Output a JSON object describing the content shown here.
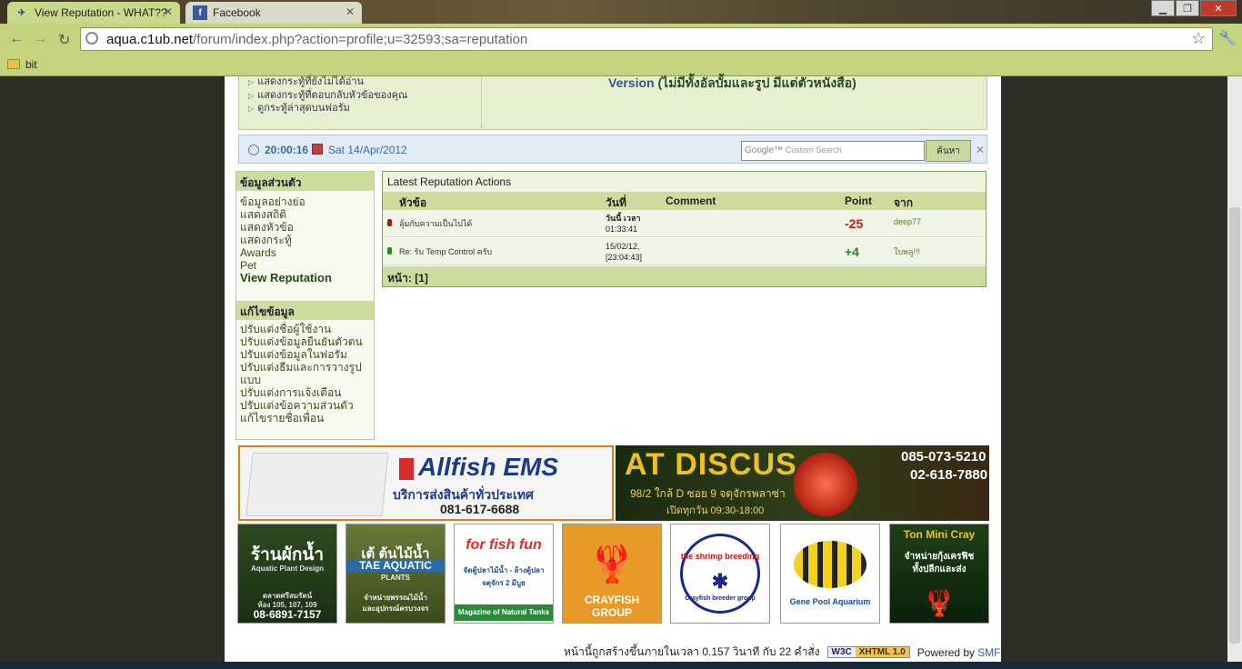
{
  "browser": {
    "tabs": [
      {
        "label": "View Reputation - WHAT??",
        "active": true
      },
      {
        "label": "Facebook",
        "active": false
      }
    ],
    "url_host": "aqua.c1ub.net",
    "url_path": "/forum/index.php?action=profile;u=32593;sa=reputation",
    "bookmarks": [
      "bit"
    ]
  },
  "menu": {
    "items": [
      "แสดงกระทู้ที่ยังไม่ได้อ่าน",
      "แสดงกระทู้ที่ตอบกลับหัวข้อของคุณ",
      "ดูกระทู้ล่าสุดบนฟอรัม"
    ],
    "version_label": "Version",
    "version_note": "(ไม่มีทั้งอัลบั้มและรูป มีแต่ตัวหนังสือ)"
  },
  "clock": {
    "time": "20:00:16",
    "date": "Sat 14/Apr/2012"
  },
  "search": {
    "placeholder": "Custom Search",
    "google": "Google™",
    "button": "ค้นหา"
  },
  "sidebar": {
    "profile_header": "ข้อมูลส่วนตัว",
    "profile_links": [
      "ข้อมูลอย่างย่อ",
      "แสดงสถิติ",
      "แสดงหัวข้อ",
      "แสดงกระทู้",
      "Awards",
      "Pet",
      "View Reputation"
    ],
    "edit_header": "แก้ไขข้อมูล",
    "edit_links": [
      "ปรับแต่งชื่อผู้ใช้งาน",
      "ปรับแต่งข้อมูลยืนยันตัวตน",
      "ปรับแต่งข้อมูลในฟอรัม",
      "ปรับแต่งธีมและการวางรูปแบบ",
      "ปรับแต่งการแจ้งเตือน",
      "ปรับแต่งข้อความส่วนตัว",
      "แก้ไขรายชื่อเพื่อน"
    ]
  },
  "reputation": {
    "title": "Latest Reputation Actions",
    "columns": [
      "หัวข้อ",
      "วันที่",
      "Comment",
      "Point",
      "จาก"
    ],
    "rows": [
      {
        "subject": "ลุ้มกับความเป็นไปได้",
        "date_line1": "วันนี้ เวลา",
        "date_line2": "01:33:41",
        "comment": "",
        "point": "-25",
        "from": "deep77",
        "dot_color": "#a01818",
        "point_color": "#d01818"
      },
      {
        "subject": "Re: รับ Temp Control ครับ",
        "date_line1": "15/02/12,",
        "date_line2": "[23:04:43]",
        "comment": "",
        "point": "+4",
        "from": "ใบพลู!!!",
        "dot_color": "#208a20",
        "point_color": "#208a20"
      }
    ],
    "pages_label": "หน้า:",
    "pages": "[1]"
  },
  "banners": {
    "allfish": {
      "brand": "Allfish EMS",
      "sub": "บริการส่งสินค้าทั่วประเทศ",
      "tel": "081-617-6688"
    },
    "atdiscus": {
      "title": "AT DISCUS",
      "addr": "98/2 ใกล้ D ซอย 9 จตุจักรพลาซ่า",
      "hours": "เปิดทุกวัน 09:30-18:00",
      "phone1": "085-073-5210",
      "phone2": "02-618-7880"
    },
    "square": [
      {
        "line1": "ร้านผักน้ำ",
        "line2": "Aquatic Plant Design",
        "line3": "ตลาดศรีสมรัตน์",
        "line4": "ห้อง 105, 107, 109",
        "line5": "08-6891-7157"
      },
      {
        "line1": "เต้ ต้นไม้น้ำ",
        "line2": "TAE AQUATIC",
        "line3": "PLANTS",
        "line4": "จำหน่ายพรรณไม้น้ำ",
        "line5": "และอุปกรณ์ครบวงจร"
      },
      {
        "line1": "for fish fun",
        "line2": "จัดตู้ปลาไม้น้ำ - ล้างตู้ปลา",
        "line3": "จตุจักร 2 มีบูธ",
        "line4": "Magazine of Natural Tanks",
        "line5": ""
      },
      {
        "line1": "CRAYFISH",
        "line2": "GROUP",
        "line3": "",
        "line4": "",
        "line5": ""
      },
      {
        "line1": "the shrimp breeding",
        "line2": "Crayfish breeder group",
        "line3": "",
        "line4": "",
        "line5": ""
      },
      {
        "line1": "Gene Pool Aquarium",
        "line2": "",
        "line3": "",
        "line4": "",
        "line5": ""
      },
      {
        "line1": "Ton Mini Cray",
        "line2": "จำหน่ายกุ้งเครฟิช",
        "line3": "ทั้งปลีกและส่ง",
        "line4": "",
        "line5": ""
      }
    ]
  },
  "footer": {
    "text": "หน้านี้ถูกสร้างขึ้นภายในเวลา 0.157 วินาที กับ 22 คำสั่ง",
    "w3c": "W3C",
    "xhtml": "XHTML 1.0",
    "powered": "Powered by",
    "smf": "SMF"
  }
}
